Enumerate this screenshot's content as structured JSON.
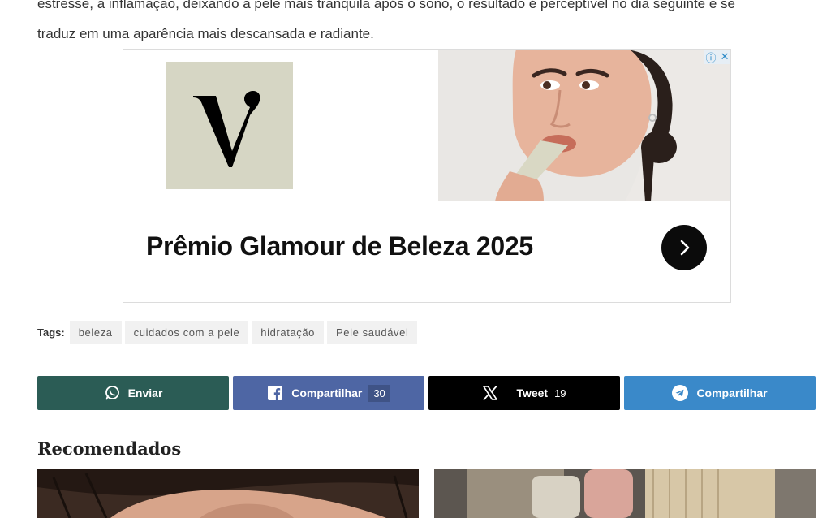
{
  "article": {
    "lines": [
      "estresse, a inflamação, deixando a pele mais tranquila após o sono, o resultado é perceptível no dia seguinte e se",
      "traduz em uma aparência mais descansada e radiante."
    ]
  },
  "ad": {
    "logo_letter": "V",
    "headline": "Prêmio Glamour de Beleza 2025",
    "info_icon": "info-icon",
    "close_icon": "close-icon",
    "arrow_icon": "chevron-right-icon"
  },
  "tags": {
    "label": "Tags:",
    "items": [
      "beleza",
      "cuidados com a pele",
      "hidratação",
      "Pele saudável"
    ]
  },
  "share": {
    "whatsapp": {
      "label": "Enviar",
      "icon": "whatsapp-icon",
      "color": "#2b5c55"
    },
    "facebook": {
      "label": "Compartilhar",
      "count": "30",
      "icon": "facebook-icon",
      "color": "#4e66a4"
    },
    "x": {
      "label": "Tweet",
      "count": "19",
      "icon": "x-icon",
      "color": "#000000"
    },
    "telegram": {
      "label": "Compartilhar",
      "icon": "telegram-icon",
      "color": "#3a89c9"
    }
  },
  "recommended": {
    "title": "Recomendados"
  }
}
